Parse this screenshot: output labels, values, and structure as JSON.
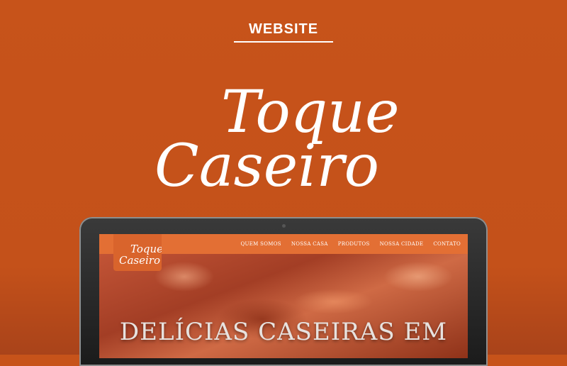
{
  "header": {
    "label": "WEBSITE"
  },
  "logo": {
    "line1": "Toque",
    "line2": "Caseiro"
  },
  "site": {
    "nav": [
      "QUEM SOMOS",
      "NOSSA CASA",
      "PRODUTOS",
      "NOSSA CIDADE",
      "CONTATO"
    ],
    "logo_line1": "Toque",
    "logo_line2": "Caseiro",
    "hero_title": "DELÍCIAS CASEIRAS EM"
  },
  "colors": {
    "background": "#c4511a",
    "nav": "#e36f34",
    "text": "#ffffff"
  }
}
